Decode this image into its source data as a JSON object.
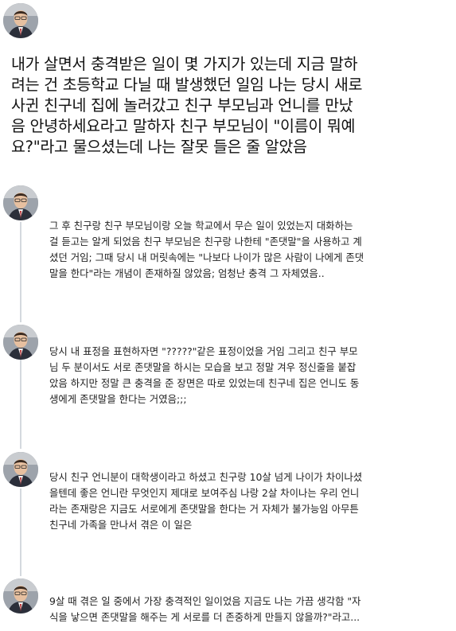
{
  "thread": {
    "main_post": {
      "avatar": "person-avatar",
      "text": "내가 살면서 충격받은 일이 몇 가지가 있는데 지금 말하\n려는 건 초등학교 다닐 때 발생했던 일임 나는 당시 새로\n사귄 친구네 집에 놀러갔고 친구 부모님과 언니를 만났\n음 안녕하세요라고 말하자 친구 부모님이 \"이름이 뭐예\n요?\"라고 물으셨는데 나는 잘못 들은 줄 알았음"
    },
    "replies": [
      {
        "avatar": "person-avatar",
        "text": "그 후 친구랑 친구 부모님이랑 오늘 학교에서 무슨 일이 있었는지 대화하는\n걸 듣고는 알게 되었음 친구 부모님은 친구랑 나한테 \"존댓말\"을 사용하고 계\n셨던 거임; 그때 당시 내 머릿속에는 \"나보다 나이가 많은 사람이 나에게 존댓\n말을 한다\"라는 개념이 존재하질 않았음; 엄청난 충격 그 자체였음.."
      },
      {
        "avatar": "person-avatar",
        "text": "당시 내 표정을 표현하자면 \"?????\"같은 표정이었을 거임 그리고 친구 부모\n님 두 분이서도 서로 존댓말을 하시는 모습을 보고 정말 겨우 정신줄을 붙잡\n았음 하지만 정말 큰 충격을 준 장면은 따로 있었는데 친구네 집은 언니도 동\n생에게 존댓말을 한다는 거였음;;;"
      },
      {
        "avatar": "person-avatar",
        "text": "당시 친구 언니분이 대학생이라고 하셨고 친구랑 10살 넘게 나이가 차이나셨\n을텐데 좋은 언니란 무엇인지 제대로 보여주심 나랑 2살 차이나는 우리 언니\n라는 존재랑은 지금도 서로에게 존댓말을 한다는 거 자체가 불가능임 아무튼\n친구네 가족을 만나서 겪은 이 일은"
      },
      {
        "avatar": "person-avatar",
        "text": "9살 때 겪은 일 중에서 가장 충격적인 일이었음 지금도 나는 가끔 생각함 \"자\n식을 낳으면 존댓말을 해주는 게 서로를 더 존중하게 만들지 않을까?\"라고..."
      }
    ]
  }
}
